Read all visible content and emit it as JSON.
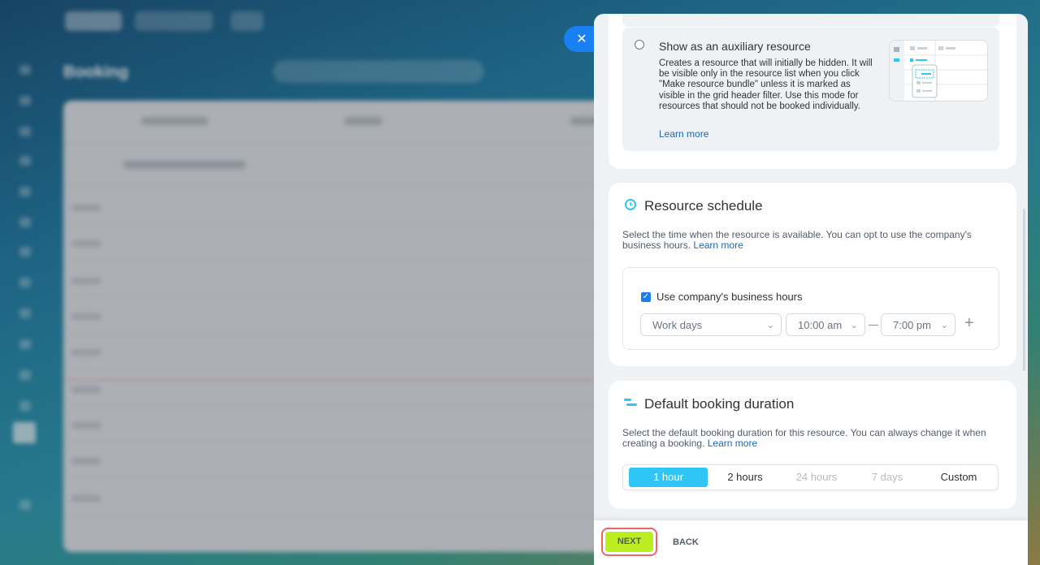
{
  "background_app": {
    "title": "Booking"
  },
  "aux_option": {
    "title": "Show as an auxiliary resource",
    "description": "Creates a resource that will initially be hidden. It will be visible only in the resource list when you click \"Make resource bundle\" unless it is marked as visible in the grid header filter. Use this mode for resources that should not be booked individually.",
    "learn_more": "Learn more"
  },
  "schedule": {
    "title": "Resource schedule",
    "description": "Select the time when the resource is available. You can opt to use the company's business hours.",
    "learn_more": "Learn more",
    "use_business_hours_label": "Use company's business hours",
    "use_business_hours_checked": true,
    "days_select": "Work days",
    "from_time": "10:00 am",
    "to_time": "7:00 pm"
  },
  "duration": {
    "title": "Default booking duration",
    "description": "Select the default booking duration for this resource. You can always change it when creating a booking.",
    "learn_more": "Learn more",
    "options": [
      {
        "label": "1 hour",
        "state": "selected"
      },
      {
        "label": "2 hours",
        "state": "normal"
      },
      {
        "label": "24 hours",
        "state": "disabled"
      },
      {
        "label": "7 days",
        "state": "disabled"
      },
      {
        "label": "Custom",
        "state": "normal"
      }
    ]
  },
  "footer": {
    "next_label": "NEXT",
    "back_label": "BACK"
  },
  "colors": {
    "accent_blue": "#1a7ff0",
    "segment_selected": "#2fc6f6",
    "next_green": "#bbed21",
    "highlight_red": "#f06363"
  }
}
